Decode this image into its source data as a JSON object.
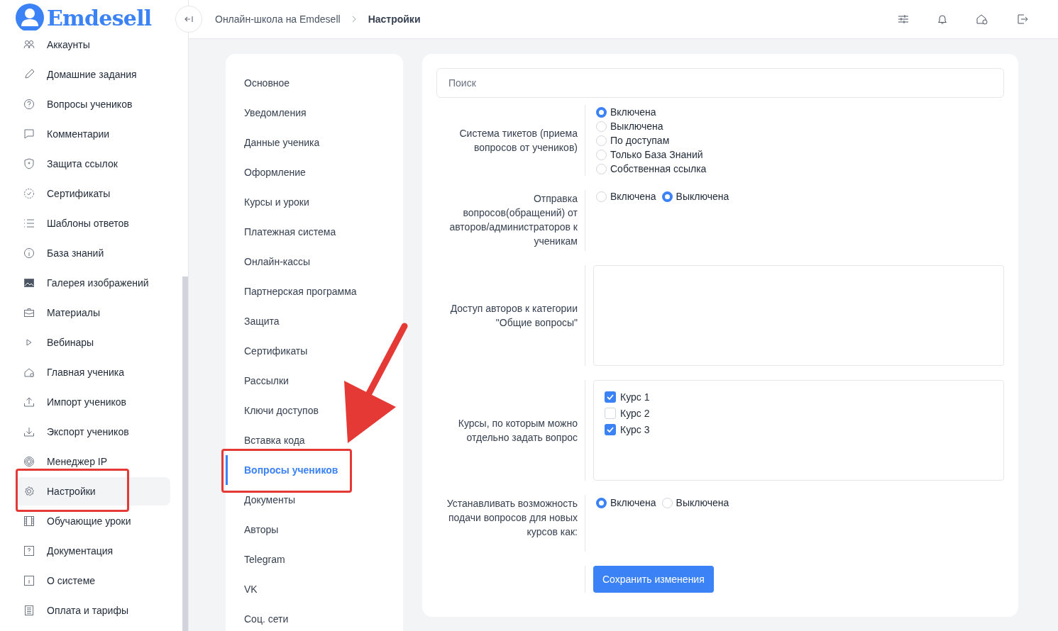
{
  "logo": {
    "text": "Emdesell"
  },
  "sidebar": {
    "items": [
      {
        "label": "Аккаунты",
        "selected": false
      },
      {
        "label": "Домашние задания",
        "selected": false
      },
      {
        "label": "Вопросы учеников",
        "selected": false
      },
      {
        "label": "Комментарии",
        "selected": false
      },
      {
        "label": "Защита ссылок",
        "selected": false
      },
      {
        "label": "Сертификаты",
        "selected": false
      },
      {
        "label": "Шаблоны ответов",
        "selected": false
      },
      {
        "label": "База знаний",
        "selected": false
      },
      {
        "label": "Галерея изображений",
        "selected": false
      },
      {
        "label": "Материалы",
        "selected": false
      },
      {
        "label": "Вебинары",
        "selected": false
      },
      {
        "label": "Главная ученика",
        "selected": false
      },
      {
        "label": "Импорт учеников",
        "selected": false
      },
      {
        "label": "Экспорт учеников",
        "selected": false
      },
      {
        "label": "Менеджер IP",
        "selected": false
      },
      {
        "label": "Настройки",
        "selected": true
      },
      {
        "label": "Обучающие уроки",
        "selected": false
      },
      {
        "label": "Документация",
        "selected": false
      },
      {
        "label": "О системе",
        "selected": false
      },
      {
        "label": "Оплата и тарифы",
        "selected": false
      }
    ]
  },
  "breadcrumbs": [
    {
      "label": "Онлайн-школа на Emdesell",
      "current": false
    },
    {
      "label": "Настройки",
      "current": true
    }
  ],
  "settings_nav": {
    "items": [
      {
        "label": "Основное",
        "selected": false
      },
      {
        "label": "Уведомления",
        "selected": false
      },
      {
        "label": "Данные ученика",
        "selected": false
      },
      {
        "label": "Оформление",
        "selected": false
      },
      {
        "label": "Курсы и уроки",
        "selected": false
      },
      {
        "label": "Платежная система",
        "selected": false
      },
      {
        "label": "Онлайн-кассы",
        "selected": false
      },
      {
        "label": "Партнерская программа",
        "selected": false
      },
      {
        "label": "Защита",
        "selected": false
      },
      {
        "label": "Сертификаты",
        "selected": false
      },
      {
        "label": "Рассылки",
        "selected": false
      },
      {
        "label": "Ключи доступов",
        "selected": false
      },
      {
        "label": "Вставка кода",
        "selected": false
      },
      {
        "label": "Вопросы учеников",
        "selected": true
      },
      {
        "label": "Документы",
        "selected": false
      },
      {
        "label": "Авторы",
        "selected": false
      },
      {
        "label": "Telegram",
        "selected": false
      },
      {
        "label": "VK",
        "selected": false
      },
      {
        "label": "Соц. сети",
        "selected": false
      }
    ]
  },
  "search": {
    "placeholder": "Поиск"
  },
  "fields": [
    {
      "kind": "radio_stack",
      "label": "Система тикетов (приема вопросов от учеников)",
      "options": [
        {
          "label": "Включена",
          "selected": true
        },
        {
          "label": "Выключена",
          "selected": false
        },
        {
          "label": "По доступам",
          "selected": false
        },
        {
          "label": "Только База Знаний",
          "selected": false
        },
        {
          "label": "Собственная ссылка",
          "selected": false
        }
      ]
    },
    {
      "kind": "radio_inline",
      "label": "Отправка вопросов(обращений) от авторов/администраторов к ученикам",
      "options": [
        {
          "label": "Включена",
          "selected": false
        },
        {
          "label": "Выключена",
          "selected": true
        }
      ]
    },
    {
      "kind": "textarea",
      "label": "Доступ авторов к категории \"Общие вопросы\""
    },
    {
      "kind": "checklist",
      "label": "Курсы, по которым можно отдельно задать вопрос",
      "options": [
        {
          "label": "Курс 1",
          "checked": true
        },
        {
          "label": "Курс 2",
          "checked": false
        },
        {
          "label": "Курс 3",
          "checked": true
        }
      ]
    },
    {
      "kind": "radio_inline",
      "label": "Устанавливать возможность подачи вопросов для новых курсов как:",
      "options": [
        {
          "label": "Включена",
          "selected": true
        },
        {
          "label": "Выключена",
          "selected": false
        }
      ]
    }
  ],
  "save_button": {
    "label": "Сохранить изменения"
  }
}
